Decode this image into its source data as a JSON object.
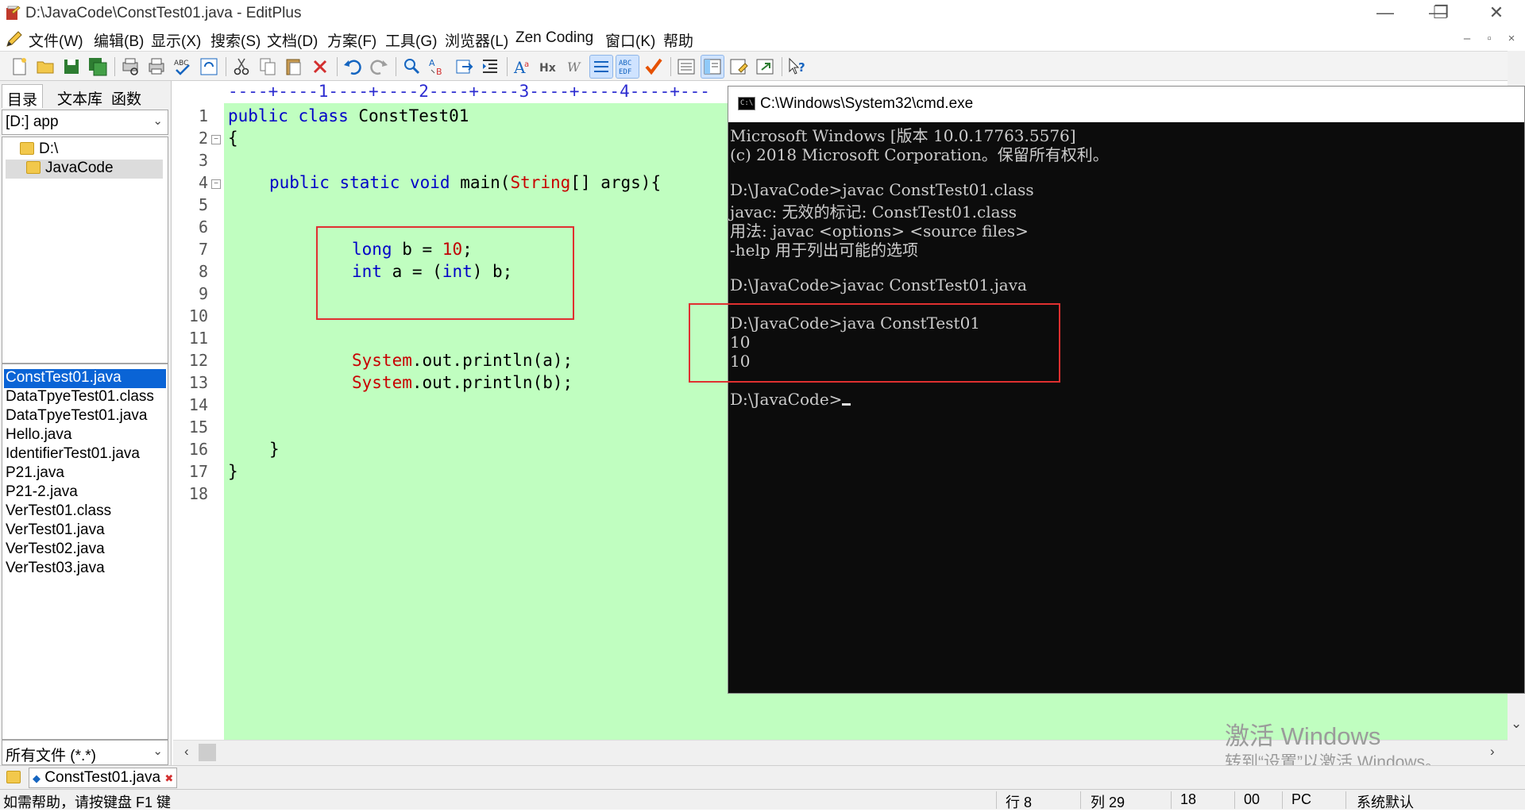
{
  "window": {
    "title": "D:\\JavaCode\\ConstTest01.java - EditPlus",
    "minimize": "—",
    "restore": "❐",
    "close": "✕"
  },
  "menu": [
    "文件(W)",
    "编辑(B)",
    "显示(X)",
    "搜索(S)",
    "文档(D)",
    "方案(F)",
    "工具(G)",
    "浏览器(L)",
    "Zen Coding",
    "窗口(K)",
    "帮助"
  ],
  "mdi_buttons": [
    "–",
    "▫",
    "×"
  ],
  "left_panel": {
    "tabs": [
      "目录",
      "文本库",
      "函数"
    ],
    "drive": "[D:] app",
    "tree": [
      "D:\\",
      "JavaCode"
    ],
    "files": [
      "ConstTest01.java",
      "DataTpyeTest01.class",
      "DataTpyeTest01.java",
      "Hello.java",
      "IdentifierTest01.java",
      "P21.java",
      "P21-2.java",
      "VerTest01.class",
      "VerTest01.java",
      "VerTest02.java",
      "VerTest03.java"
    ],
    "filter": "所有文件 (*.*)"
  },
  "editor": {
    "ruler": "----+----1----+----2----+----3----+----4----+---",
    "line_numbers": [
      "1",
      "2",
      "3",
      "4",
      "5",
      "6",
      "7",
      "8",
      "9",
      "10",
      "11",
      "12",
      "13",
      "14",
      "15",
      "16",
      "17",
      "18"
    ],
    "code": {
      "l1_kw": "public class",
      "l1_name": " ConstTest01",
      "l2": "{",
      "l4_kw": "public static void",
      "l4_main": " main(",
      "l4_type": "String",
      "l4_rest": "[] args){",
      "l7_kw": "long",
      "l7_mid": " b = ",
      "l7_num": "10",
      "l7_end": ";",
      "l8_kw": "int",
      "l8_mid": " a = (",
      "l8_kw2": "int",
      "l8_end": ") b;",
      "l12_type": "System",
      "l12_rest": ".out.println(a);",
      "l13_type": "System",
      "l13_rest": ".out.println(b);",
      "l16": "}",
      "l17": "}"
    }
  },
  "cmd": {
    "title": "C:\\Windows\\System32\\cmd.exe",
    "icon_text": "C:\\",
    "lines": [
      "Microsoft Windows [版本 10.0.17763.5576]",
      "(c) 2018 Microsoft Corporation。保留所有权利。",
      "",
      "D:\\JavaCode>javac ConstTest01.class",
      "javac: 无效的标记: ConstTest01.class",
      "用法: javac <options> <source files>",
      "-help 用于列出可能的选项",
      "",
      "D:\\JavaCode>javac ConstTest01.java",
      "",
      "D:\\JavaCode>java ConstTest01",
      "10",
      "10",
      "",
      "D:\\JavaCode>"
    ]
  },
  "watermark": {
    "line1": "激活 Windows",
    "line2": "转到“设置”以激活 Windows。"
  },
  "doc_tab": "ConstTest01.java",
  "status": {
    "help": "如需帮助，请按键盘 F1 键",
    "row": "行 8",
    "col": "列 29",
    "num1": "18",
    "num2": "00",
    "mode": "PC",
    "encoding": "系统默认"
  }
}
